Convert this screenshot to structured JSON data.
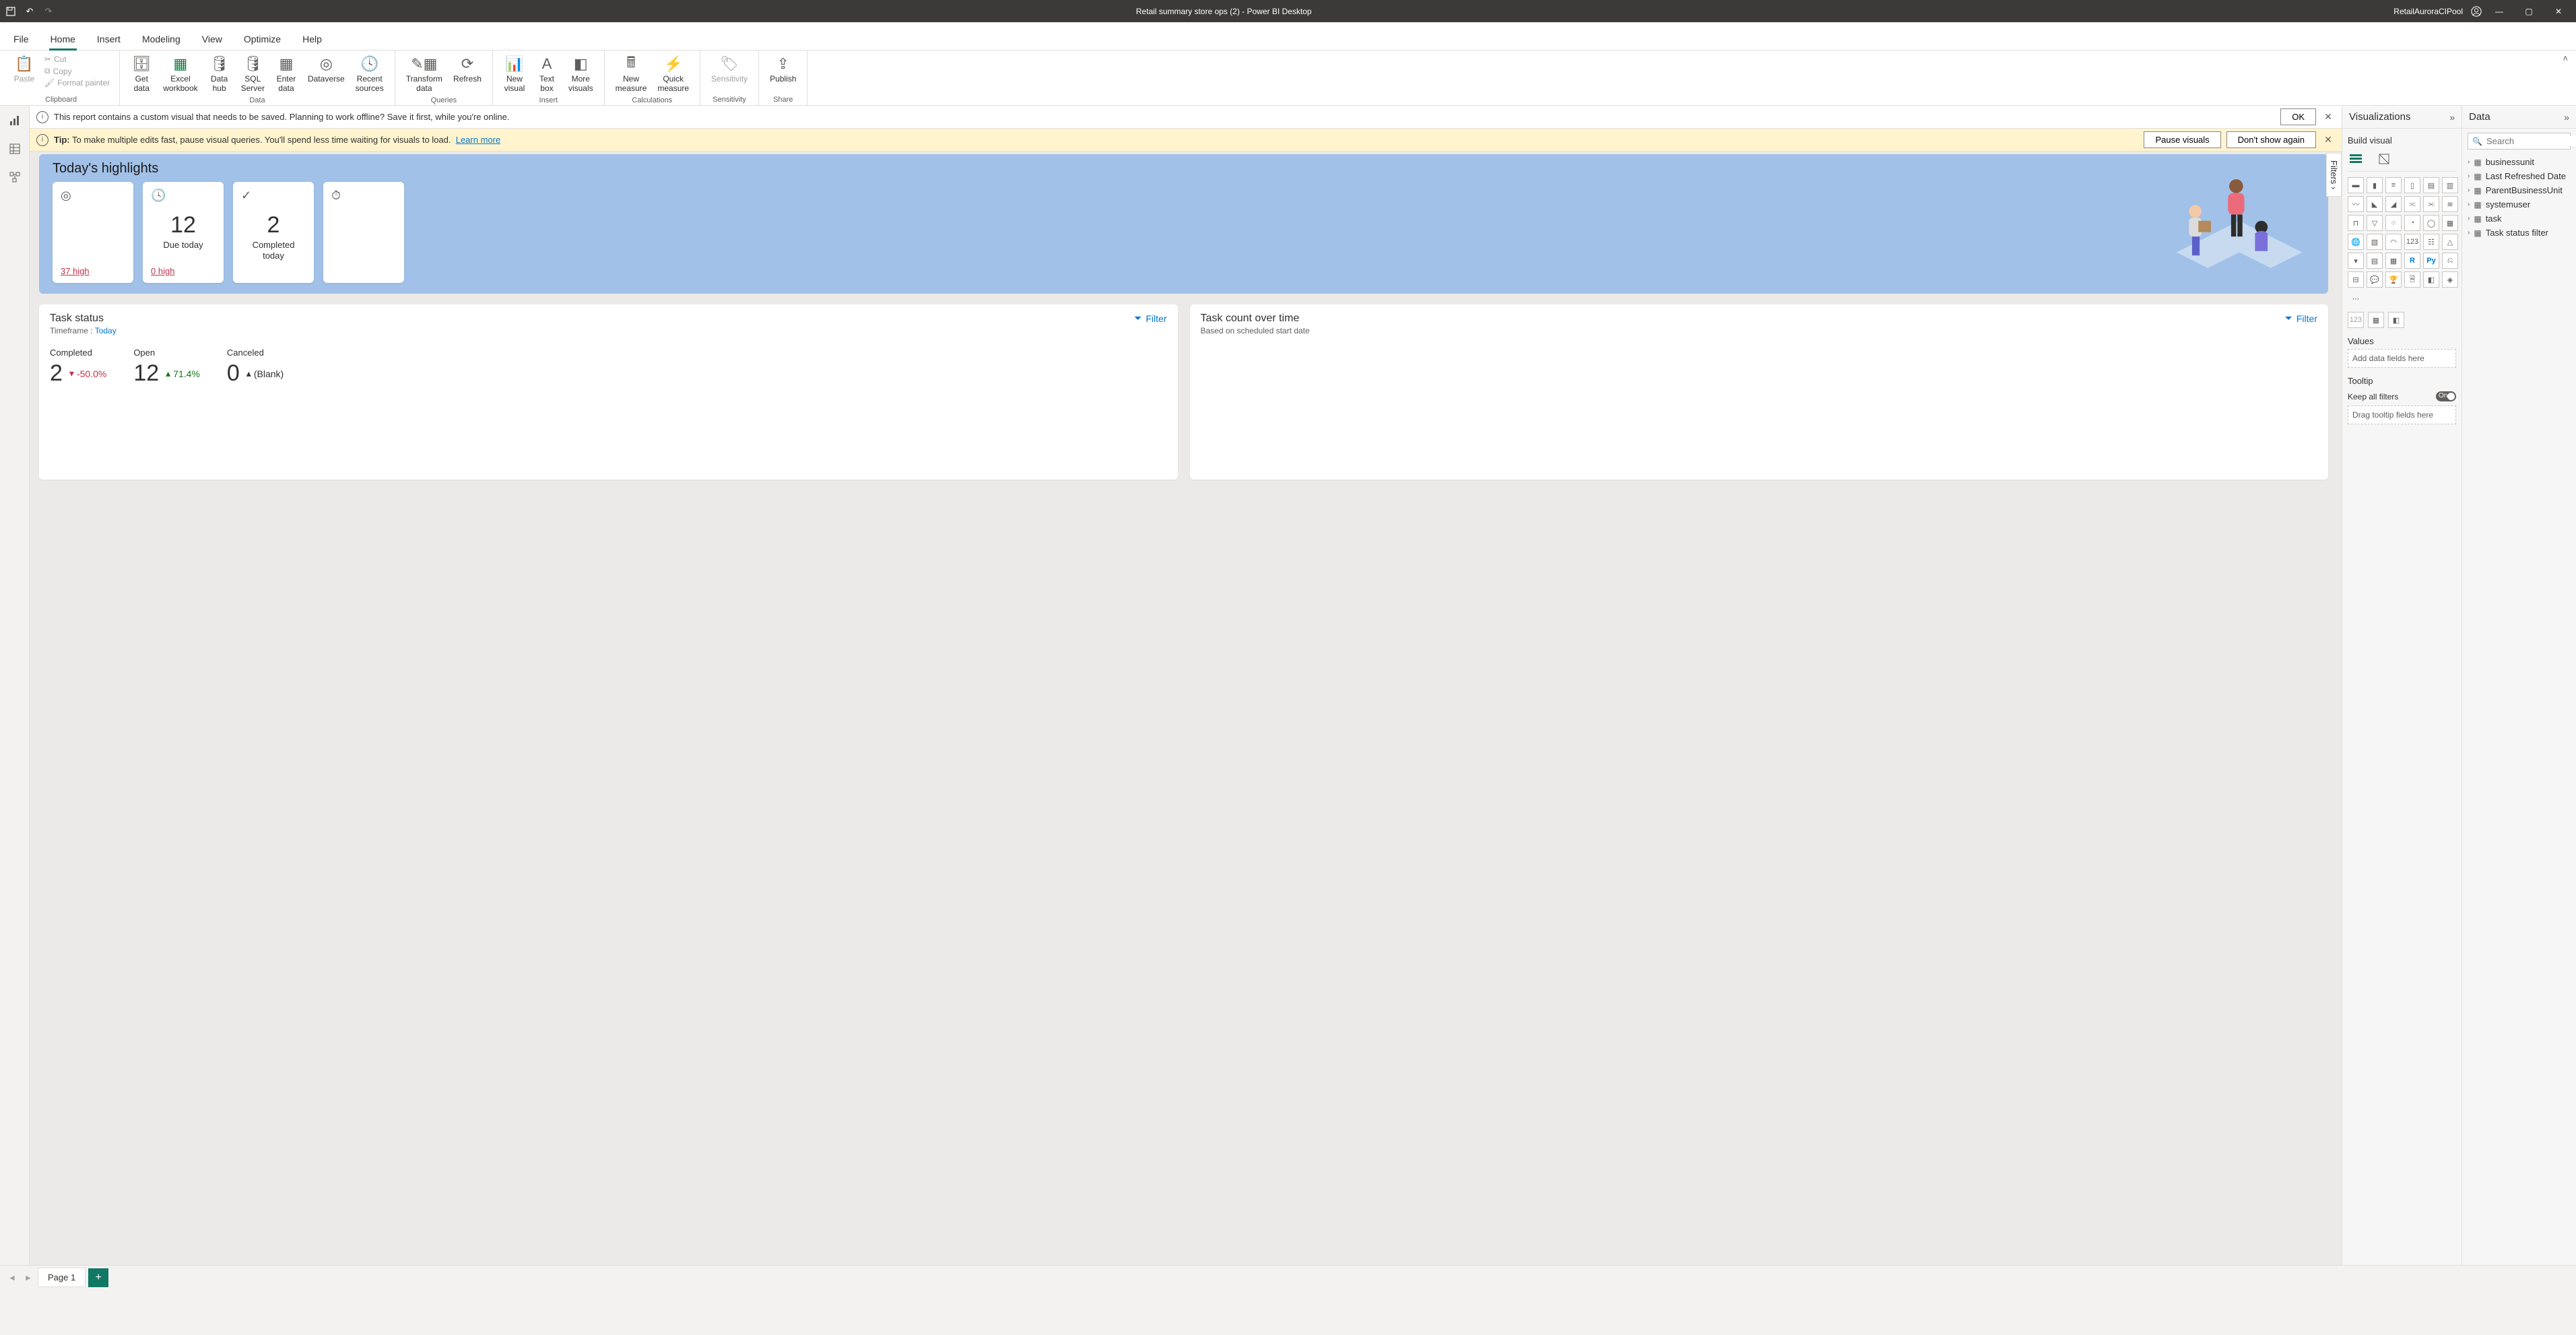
{
  "titlebar": {
    "title": "Retail summary store ops (2) - Power BI Desktop",
    "user": "RetailAuroraCIPool"
  },
  "menu": {
    "tabs": [
      "File",
      "Home",
      "Insert",
      "Modeling",
      "View",
      "Optimize",
      "Help"
    ],
    "active": "Home"
  },
  "ribbon": {
    "clipboard": {
      "paste": "Paste",
      "cut": "Cut",
      "copy": "Copy",
      "format_painter": "Format painter",
      "label": "Clipboard"
    },
    "data": {
      "get_data": "Get\ndata",
      "excel": "Excel\nworkbook",
      "data_hub": "Data\nhub",
      "sql": "SQL\nServer",
      "enter_data": "Enter\ndata",
      "dataverse": "Dataverse",
      "recent": "Recent\nsources",
      "label": "Data"
    },
    "queries": {
      "transform": "Transform\ndata",
      "refresh": "Refresh",
      "label": "Queries"
    },
    "insert": {
      "new_visual": "New\nvisual",
      "text_box": "Text\nbox",
      "more_visuals": "More\nvisuals",
      "label": "Insert"
    },
    "calculations": {
      "new_measure": "New\nmeasure",
      "quick_measure": "Quick\nmeasure",
      "label": "Calculations"
    },
    "sensitivity": {
      "btn": "Sensitivity",
      "label": "Sensitivity"
    },
    "share": {
      "publish": "Publish",
      "label": "Share"
    }
  },
  "infobar1": {
    "text": "This report contains a custom visual that needs to be saved. Planning to work offline? Save it first, while you're online.",
    "ok": "OK"
  },
  "infobar2": {
    "tip_label": "Tip:",
    "text": "To make multiple edits fast, pause visual queries. You'll spend less time waiting for visuals to load.",
    "learn_more": "Learn more",
    "pause": "Pause visuals",
    "dont_show": "Don't show again"
  },
  "highlights": {
    "title": "Today's highlights",
    "cards": [
      {
        "icon": "target",
        "num": "",
        "label": "",
        "foot": "37 high"
      },
      {
        "icon": "clock",
        "num": "12",
        "label": "Due today",
        "foot": "0 high"
      },
      {
        "icon": "check",
        "num": "2",
        "label": "Completed today",
        "foot": ""
      },
      {
        "icon": "stopwatch",
        "num": "",
        "label": "",
        "foot": ""
      }
    ]
  },
  "task_status": {
    "title": "Task status",
    "timeframe_label": "Timeframe :",
    "timeframe_value": "Today",
    "filter": "Filter",
    "cols": [
      {
        "label": "Completed",
        "num": "2",
        "delta": "-50.0%",
        "dir": "down"
      },
      {
        "label": "Open",
        "num": "12",
        "delta": "71.4%",
        "dir": "up"
      },
      {
        "label": "Canceled",
        "num": "0",
        "delta": "(Blank)",
        "dir": "blank"
      }
    ]
  },
  "task_count": {
    "title": "Task count over time",
    "sub": "Based on scheduled start date",
    "filter": "Filter"
  },
  "filters_tab": "Filters",
  "viz_pane": {
    "title": "Visualizations",
    "sub": "Build visual",
    "values": "Values",
    "values_placeholder": "Add data fields here",
    "tooltip": "Tooltip",
    "keep_filters": "Keep all filters",
    "keep_filters_state": "On",
    "tooltip_placeholder": "Drag tooltip fields here"
  },
  "data_pane": {
    "title": "Data",
    "search_placeholder": "Search",
    "tables": [
      "businessunit",
      "Last Refreshed Date",
      "ParentBusinessUnit",
      "systemuser",
      "task",
      "Task status filter"
    ]
  },
  "pages": {
    "page1": "Page 1"
  }
}
